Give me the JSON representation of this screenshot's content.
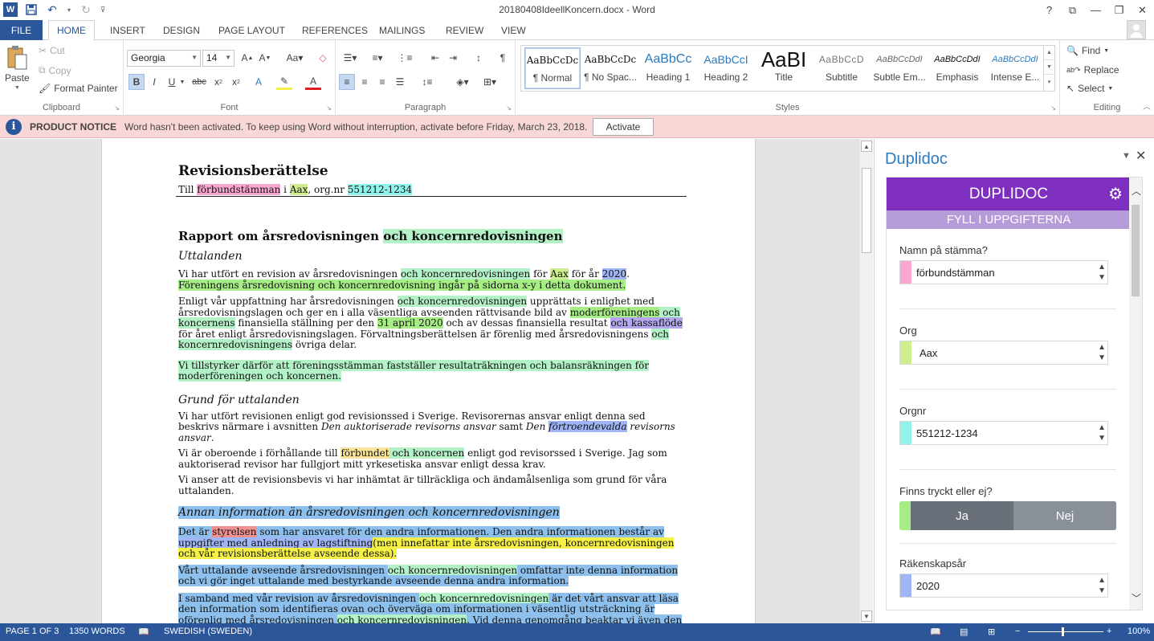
{
  "app": {
    "title": "20180408IdeellKoncern.docx - Word",
    "logo": "W",
    "win_help": "?",
    "win_restore_ribbon": "⧉",
    "win_minimize": "—",
    "win_maximize": "❐",
    "win_close": "✕"
  },
  "tabs": [
    "FILE",
    "HOME",
    "INSERT",
    "DESIGN",
    "PAGE LAYOUT",
    "REFERENCES",
    "MAILINGS",
    "REVIEW",
    "VIEW"
  ],
  "ribbon": {
    "clipboard": {
      "paste": "Paste",
      "cut": "Cut",
      "copy": "Copy",
      "format_painter": "Format Painter",
      "label": "Clipboard"
    },
    "font": {
      "family": "Georgia",
      "size": "14",
      "label": "Font"
    },
    "paragraph": {
      "label": "Paragraph"
    },
    "styles": {
      "label": "Styles",
      "items": [
        {
          "preview": "AaBbCcDc",
          "name": "¶ Normal"
        },
        {
          "preview": "AaBbCcDc",
          "name": "¶ No Spac..."
        },
        {
          "preview": "AaBbCc",
          "name": "Heading 1"
        },
        {
          "preview": "AaBbCcI",
          "name": "Heading 2"
        },
        {
          "preview": "AaBI",
          "name": "Title"
        },
        {
          "preview": "AaBbCcD",
          "name": "Subtitle"
        },
        {
          "preview": "AaBbCcDdI",
          "name": "Subtle Em..."
        },
        {
          "preview": "AaBbCcDdI",
          "name": "Emphasis"
        },
        {
          "preview": "AaBbCcDdI",
          "name": "Intense E..."
        }
      ]
    },
    "editing": {
      "find": "Find",
      "replace": "Replace",
      "select": "Select",
      "label": "Editing"
    }
  },
  "notice": {
    "title": "PRODUCT NOTICE",
    "message": "Word hasn't been activated. To keep using Word without interruption, activate before Friday, March 23, 2018.",
    "button": "Activate"
  },
  "document": {
    "title": "Revisionsberättelse",
    "to_line": {
      "a": "Till ",
      "b": "förbundstämman",
      "c": " i ",
      "d": " Aax",
      "e": ", org.nr ",
      "f": "551212-1234"
    },
    "h_report": {
      "a": "Rapport om årsredovisningen ",
      "b": "och koncernredovisningen"
    },
    "h_uttalanden": "Uttalanden",
    "p1": {
      "a": "Vi har utfört en revision av årsredovisningen ",
      "b": "och koncernredovisningen",
      "c": " för ",
      "d": " Aax",
      "e": " för år ",
      "f": "2020",
      "g": ". ",
      "h": "Föreningens årsredovisning och koncernredovisning ingår på sidorna x-y i detta dokument."
    },
    "p2": {
      "a": "Enligt vår uppfattning har årsredovisningen ",
      "b": "och koncernredovisningen",
      "c": " upprättats i enlighet med årsredovisningslagen och ger en i alla väsentliga avseenden rättvisande bild av ",
      "d": "moderföreningens",
      "e": " och koncernens",
      "f": " finansiella ställning per den ",
      "g": "31 april 2020",
      "h": " och av dessas finansiella resultat ",
      "i": "och kassaflöde",
      "j": " för året enligt årsredovisningslagen. Förvaltningsberättelsen är förenlig med årsredovisningens ",
      "k": "och koncernredovisningens",
      "l": " övriga delar."
    },
    "p3": "Vi tillstyrker därför att föreningsstämman fastställer resultaträkningen och balansräkningen för moderföreningen och koncernen.",
    "h_grund": "Grund för uttalanden",
    "p4": {
      "a": "Vi har utfört revisionen enligt god revisionssed i Sverige. Revisorernas ansvar enligt denna sed beskrivs närmare i avsnitten ",
      "b": "Den auktoriserade revisorns ansvar",
      "c": " samt ",
      "d": "Den ",
      "e": "förtroendevalda",
      "f": " revisorns ansvar",
      "g": "."
    },
    "p5": {
      "a": "Vi är oberoende i förhållande till ",
      "b": "förbundet",
      "c": " och koncernen",
      "d": " enligt god revisorssed i Sverige. Jag som auktoriserad revisor har fullgjort mitt yrkesetiska ansvar enligt dessa krav."
    },
    "p6": "Vi anser att de revisionsbevis vi har inhämtat är tillräckliga och ändamålsenliga som grund för våra uttalanden.",
    "h_annan": "Annan information än årsredovisningen och koncernredovisningen",
    "p7": {
      "a": "Det är ",
      "b": "styrelsen",
      "c": " som har ansvaret för den andra informationen. Den andra informationen består av ",
      "d": "uppgifter med anledning av lagstiftning",
      "e": "(men innefattar inte årsredovisningen, koncernredovisningen och vår revisionsberättelse avseende dessa)."
    },
    "p8": {
      "a": "Vårt uttalande avseende årsredovisningen ",
      "b": "och koncernredovisningen",
      "c": " omfattar inte denna information och vi gör inget uttalande med bestyrkande avseende denna andra information."
    },
    "p9": {
      "a": "I samband med vår revision av årsredovisningen ",
      "b": "och koncernredovisningen",
      "c": " är det vårt ansvar att läsa den information som identifieras ovan och överväga om informationen i väsentlig utsträckning är oförenlig med årsredovisningen ",
      "d": "och koncernredovisningen",
      "e": ". Vid denna genomgång beaktar vi även den kunskap vi i övrigt inhämtat"
    }
  },
  "pane": {
    "title": "Duplidoc",
    "menu_icon": "▼",
    "close_icon": "✕",
    "brand": "DUPLIDOC",
    "gear": "⚙",
    "subtitle": "FYLL I UPPGIFTERNA",
    "fields": [
      {
        "label": "Namn på stämma?",
        "value": "förbundstämman",
        "color": "#f8a8d0"
      },
      {
        "label": "Org",
        "value": "Aax",
        "color": "#cfee8f"
      },
      {
        "label": "Orgnr",
        "value": "551212-1234",
        "color": "#8ff5ea"
      },
      {
        "label": "Räkenskapsår",
        "value": "2020",
        "color": "#9fb5f5"
      }
    ],
    "toggle": {
      "label": "Finns tryckt eller ej?",
      "yes": "Ja",
      "no": "Nej",
      "selected": "Ja",
      "color": "#a7ed86"
    }
  },
  "status": {
    "page": "PAGE 1 OF 3",
    "words": "1350 WORDS",
    "language": "SWEDISH (SWEDEN)",
    "zoom": "100%",
    "zoom_level": 1.0
  }
}
